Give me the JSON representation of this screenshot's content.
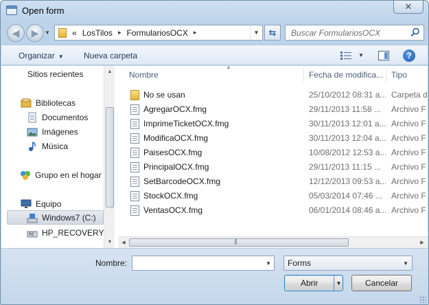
{
  "window": {
    "title": "Open form",
    "close_glyph": "✕"
  },
  "navigation": {
    "back_icon": "back-arrow-icon",
    "forward_icon": "forward-arrow-icon"
  },
  "address_bar": {
    "prefix": "«",
    "segments": [
      "LosTilos",
      "FormulariosOCX"
    ],
    "separator": "▸"
  },
  "search": {
    "placeholder": "Buscar FormulariosOCX"
  },
  "toolbar": {
    "organize_label": "Organizar",
    "new_folder_label": "Nueva carpeta"
  },
  "nav_pane": {
    "items": [
      {
        "label": "Sitios recientes",
        "icon": "recent-places-icon"
      },
      {
        "label": "Bibliotecas",
        "icon": "libraries-icon"
      },
      {
        "label": "Documentos",
        "icon": "documents-icon"
      },
      {
        "label": "Imágenes",
        "icon": "pictures-icon"
      },
      {
        "label": "Música",
        "icon": "music-icon"
      },
      {
        "label": "Grupo en el hogar",
        "icon": "homegroup-icon"
      },
      {
        "label": "Equipo",
        "icon": "computer-icon"
      },
      {
        "label": "Windows7 (C:)",
        "icon": "drive-icon"
      },
      {
        "label": "HP_RECOVERY (D",
        "icon": "drive-icon"
      }
    ]
  },
  "columns": {
    "name": "Nombre",
    "date": "Fecha de modifica...",
    "type": "Tipo"
  },
  "files": [
    {
      "name": "No se usan",
      "date": "25/10/2012 08:31 a...",
      "type": "Carpeta de",
      "kind": "folder"
    },
    {
      "name": "AgregarOCX.fmg",
      "date": "29/11/2013 11:58 ...",
      "type": "Archivo F",
      "kind": "file"
    },
    {
      "name": "ImprimeTicketOCX.fmg",
      "date": "30/11/2013 12:01 a...",
      "type": "Archivo F",
      "kind": "file"
    },
    {
      "name": "ModificaOCX.fmg",
      "date": "30/11/2013 12:04 a...",
      "type": "Archivo F",
      "kind": "file"
    },
    {
      "name": "PaisesOCX.fmg",
      "date": "10/08/2012 12:53 a...",
      "type": "Archivo F",
      "kind": "file"
    },
    {
      "name": "PrincipalOCX.fmg",
      "date": "29/11/2013 11:15 ...",
      "type": "Archivo F",
      "kind": "file"
    },
    {
      "name": "SetBarcodeOCX.fmg",
      "date": "12/12/2013 09:53 a...",
      "type": "Archivo F",
      "kind": "file"
    },
    {
      "name": "StockOCX.fmg",
      "date": "05/03/2014 07:46 ...",
      "type": "Archivo F",
      "kind": "file"
    },
    {
      "name": "VentasOCX.fmg",
      "date": "06/01/2014 08:46 a...",
      "type": "Archivo F",
      "kind": "file"
    }
  ],
  "bottom": {
    "name_label": "Nombre:",
    "name_value": "",
    "filter_value": "Forms",
    "open_label": "Abrir",
    "cancel_label": "Cancelar"
  },
  "colors": {
    "accent": "#1e395b",
    "frame": "#c4d8ee",
    "selection": "#d3dae3"
  }
}
